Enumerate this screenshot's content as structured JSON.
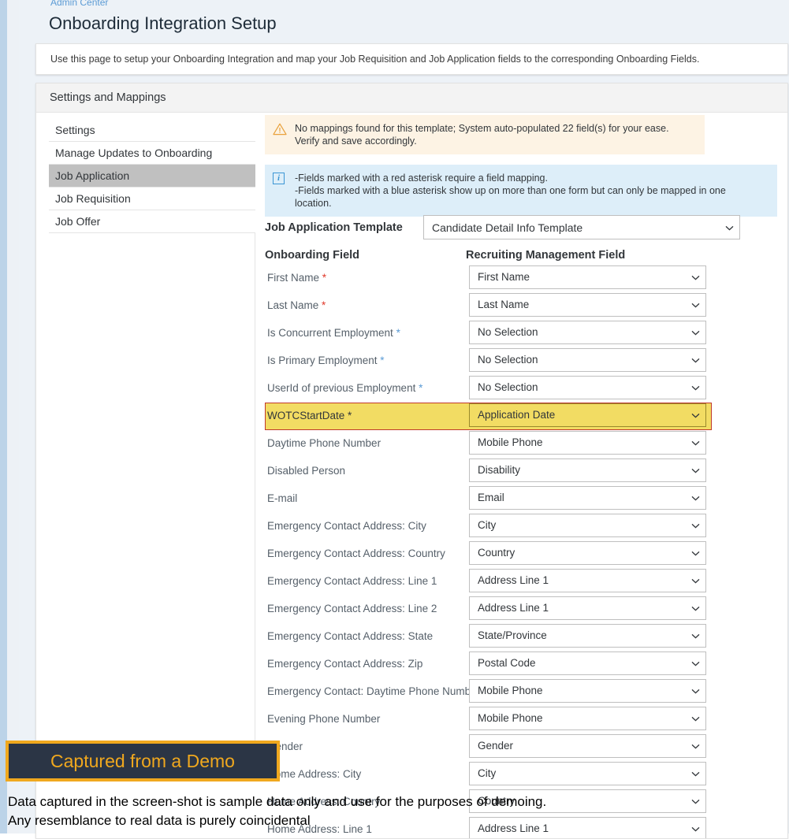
{
  "breadcrumb": "Admin Center",
  "page_title": "Onboarding Integration Setup",
  "description": "Use this page to setup your Onboarding Integration and map your Job Requisition and Job Application fields to the corresponding Onboarding Fields.",
  "card": {
    "header": "Settings and Mappings"
  },
  "sidebar": {
    "items": [
      {
        "label": "Settings",
        "selected": false
      },
      {
        "label": "Manage Updates to Onboarding",
        "selected": false
      },
      {
        "label": "Job Application",
        "selected": true
      },
      {
        "label": "Job Requisition",
        "selected": false
      },
      {
        "label": "Job Offer",
        "selected": false
      }
    ]
  },
  "alerts": {
    "warning": {
      "icon": "warning-triangle-icon",
      "line1": "No mappings found for this template; System auto-populated 22 field(s) for your ease.",
      "line2": "Verify and save accordingly.",
      "background": "#fdf3e4",
      "icon_color": "#e9a13b"
    },
    "info": {
      "icon": "info-icon",
      "line1": "-Fields marked with a red asterisk require a field mapping.",
      "line2": "-Fields marked with a blue asterisk show up on more than one form but can only be mapped in one",
      "line3": "location.",
      "background": "#ddeef9",
      "icon_color": "#3a95d4"
    }
  },
  "template": {
    "label": "Job Application Template",
    "value": "Candidate Detail Info Template"
  },
  "columns": {
    "onboarding": "Onboarding Field",
    "recruiting": "Recruiting Management Field"
  },
  "colors": {
    "asterisk_red": "#e0392b",
    "asterisk_blue": "#5b9bd5",
    "highlight_fill": "#f2dc63",
    "highlight_border": "#c0392b",
    "selected_sidebar": "#c0c0c0"
  },
  "mappings": [
    {
      "field": "First Name",
      "asterisk": "red",
      "value": "First Name",
      "highlight": false
    },
    {
      "field": "Last Name",
      "asterisk": "red",
      "value": "Last Name",
      "highlight": false
    },
    {
      "field": "Is Concurrent Employment",
      "asterisk": "blue",
      "value": "No Selection",
      "highlight": false
    },
    {
      "field": "Is Primary Employment",
      "asterisk": "blue",
      "value": "No Selection",
      "highlight": false
    },
    {
      "field": "UserId of previous Employment",
      "asterisk": "blue",
      "value": "No Selection",
      "highlight": false
    },
    {
      "field": "WOTCStartDate",
      "asterisk": "plain",
      "value": "Application Date",
      "highlight": true
    },
    {
      "field": "Daytime Phone Number",
      "asterisk": "none",
      "value": "Mobile Phone",
      "highlight": false
    },
    {
      "field": "Disabled Person",
      "asterisk": "none",
      "value": "Disability",
      "highlight": false
    },
    {
      "field": "E-mail",
      "asterisk": "none",
      "value": "Email",
      "highlight": false
    },
    {
      "field": "Emergency Contact Address: City",
      "asterisk": "none",
      "value": "City",
      "highlight": false
    },
    {
      "field": "Emergency Contact Address: Country",
      "asterisk": "none",
      "value": "Country",
      "highlight": false
    },
    {
      "field": "Emergency Contact Address: Line 1",
      "asterisk": "none",
      "value": "Address Line 1",
      "highlight": false
    },
    {
      "field": "Emergency Contact Address: Line 2",
      "asterisk": "none",
      "value": "Address Line 1",
      "highlight": false
    },
    {
      "field": "Emergency Contact Address: State",
      "asterisk": "none",
      "value": "State/Province",
      "highlight": false
    },
    {
      "field": "Emergency Contact Address: Zip",
      "asterisk": "none",
      "value": "Postal Code",
      "highlight": false
    },
    {
      "field": "Emergency Contact: Daytime Phone Number",
      "asterisk": "none",
      "value": "Mobile Phone",
      "highlight": false
    },
    {
      "field": "Evening Phone Number",
      "asterisk": "none",
      "value": "Mobile Phone",
      "highlight": false
    },
    {
      "field": "Gender",
      "asterisk": "none",
      "value": "Gender",
      "highlight": false
    },
    {
      "field": "Home Address: City",
      "asterisk": "none",
      "value": "City",
      "highlight": false
    },
    {
      "field": "Home Address: Country",
      "asterisk": "none",
      "value": "Country",
      "highlight": false
    },
    {
      "field": "Home Address: Line 1",
      "asterisk": "none",
      "value": "Address Line 1",
      "highlight": false
    }
  ],
  "overlay": {
    "badge": "Captured from a Demo",
    "badge_bg": "#2b3545",
    "badge_border": "#f0a81e",
    "badge_text_color": "#f0a81e",
    "caption_line1": "Data captured in the screen-shot is sample data only and use for the purposes of demoing.",
    "caption_line2": "Any resemblance to real data is purely coincidental"
  }
}
